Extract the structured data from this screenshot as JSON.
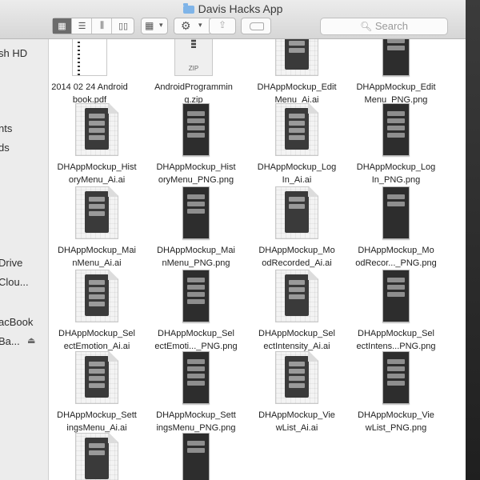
{
  "window": {
    "title": "Davis Hacks App"
  },
  "toolbar": {
    "view_modes": [
      "icon-view",
      "list-view",
      "column-view",
      "cover-flow-view"
    ],
    "search_placeholder": "Search"
  },
  "sidebar": {
    "items": [
      {
        "label": "sh HD",
        "kind": "device"
      },
      {
        "label": "nts",
        "kind": "favorite"
      },
      {
        "label": "ds",
        "kind": "favorite"
      },
      {
        "label": "Drive",
        "kind": "cloud"
      },
      {
        "label": "Clou...",
        "kind": "cloud"
      },
      {
        "label": "acBook",
        "kind": "device"
      },
      {
        "label": "Ba...",
        "kind": "device"
      }
    ]
  },
  "files": [
    {
      "name_line1": "2014 02 24 Android",
      "name_line2": "book.pdf",
      "type": "pdf"
    },
    {
      "name_line1": "AndroidProgrammin",
      "name_line2": "g.zip",
      "type": "zip",
      "icon_text": "ZIP"
    },
    {
      "name_line1": "DHAppMockup_Edit",
      "name_line2": "Menu_Ai.ai",
      "type": "ai"
    },
    {
      "name_line1": "DHAppMockup_Edit",
      "name_line2": "Menu_PNG.png",
      "type": "png"
    },
    {
      "name_line1": "DHAppMockup_Hist",
      "name_line2": "oryMenu_Ai.ai",
      "type": "ai"
    },
    {
      "name_line1": "DHAppMockup_Hist",
      "name_line2": "oryMenu_PNG.png",
      "type": "png"
    },
    {
      "name_line1": "DHAppMockup_Log",
      "name_line2": "In_Ai.ai",
      "type": "ai"
    },
    {
      "name_line1": "DHAppMockup_Log",
      "name_line2": "In_PNG.png",
      "type": "png"
    },
    {
      "name_line1": "DHAppMockup_Mai",
      "name_line2": "nMenu_Ai.ai",
      "type": "ai"
    },
    {
      "name_line1": "DHAppMockup_Mai",
      "name_line2": "nMenu_PNG.png",
      "type": "png"
    },
    {
      "name_line1": "DHAppMockup_Mo",
      "name_line2": "odRecorded_Ai.ai",
      "type": "ai"
    },
    {
      "name_line1": "DHAppMockup_Mo",
      "name_line2": "odRecor..._PNG.png",
      "type": "png"
    },
    {
      "name_line1": "DHAppMockup_Sel",
      "name_line2": "ectEmotion_Ai.ai",
      "type": "ai"
    },
    {
      "name_line1": "DHAppMockup_Sel",
      "name_line2": "ectEmoti..._PNG.png",
      "type": "png"
    },
    {
      "name_line1": "DHAppMockup_Sel",
      "name_line2": "ectIntensity_Ai.ai",
      "type": "ai"
    },
    {
      "name_line1": "DHAppMockup_Sel",
      "name_line2": "ectIntens...PNG.png",
      "type": "png"
    },
    {
      "name_line1": "DHAppMockup_Sett",
      "name_line2": "ingsMenu_Ai.ai",
      "type": "ai"
    },
    {
      "name_line1": "DHAppMockup_Sett",
      "name_line2": "ingsMenu_PNG.png",
      "type": "png"
    },
    {
      "name_line1": "DHAppMockup_Vie",
      "name_line2": "wList_Ai.ai",
      "type": "ai"
    },
    {
      "name_line1": "DHAppMockup_Vie",
      "name_line2": "wList_PNG.png",
      "type": "png"
    },
    {
      "name_line1": "",
      "name_line2": "",
      "type": "ai"
    },
    {
      "name_line1": "",
      "name_line2": "",
      "type": "png"
    }
  ]
}
